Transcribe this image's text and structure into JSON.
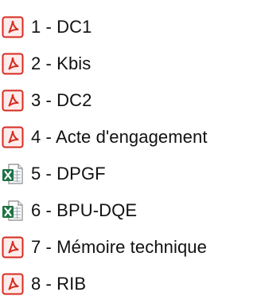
{
  "explorer": {
    "files": [
      {
        "label": "1 - DC1",
        "icon": "pdf-file-icon"
      },
      {
        "label": "2 - Kbis",
        "icon": "pdf-file-icon"
      },
      {
        "label": "3 - DC2",
        "icon": "pdf-file-icon"
      },
      {
        "label": "4 - Acte d'engagement",
        "icon": "pdf-file-icon"
      },
      {
        "label": "5 - DPGF",
        "icon": "excel-file-icon"
      },
      {
        "label": "6 - BPU-DQE",
        "icon": "excel-file-icon"
      },
      {
        "label": "7 - Mémoire technique",
        "icon": "pdf-file-icon"
      },
      {
        "label": "8 - RIB",
        "icon": "pdf-file-icon"
      }
    ]
  },
  "colors": {
    "pdf_red": "#d62b20",
    "excel_green": "#1f7244",
    "text": "#111111"
  }
}
